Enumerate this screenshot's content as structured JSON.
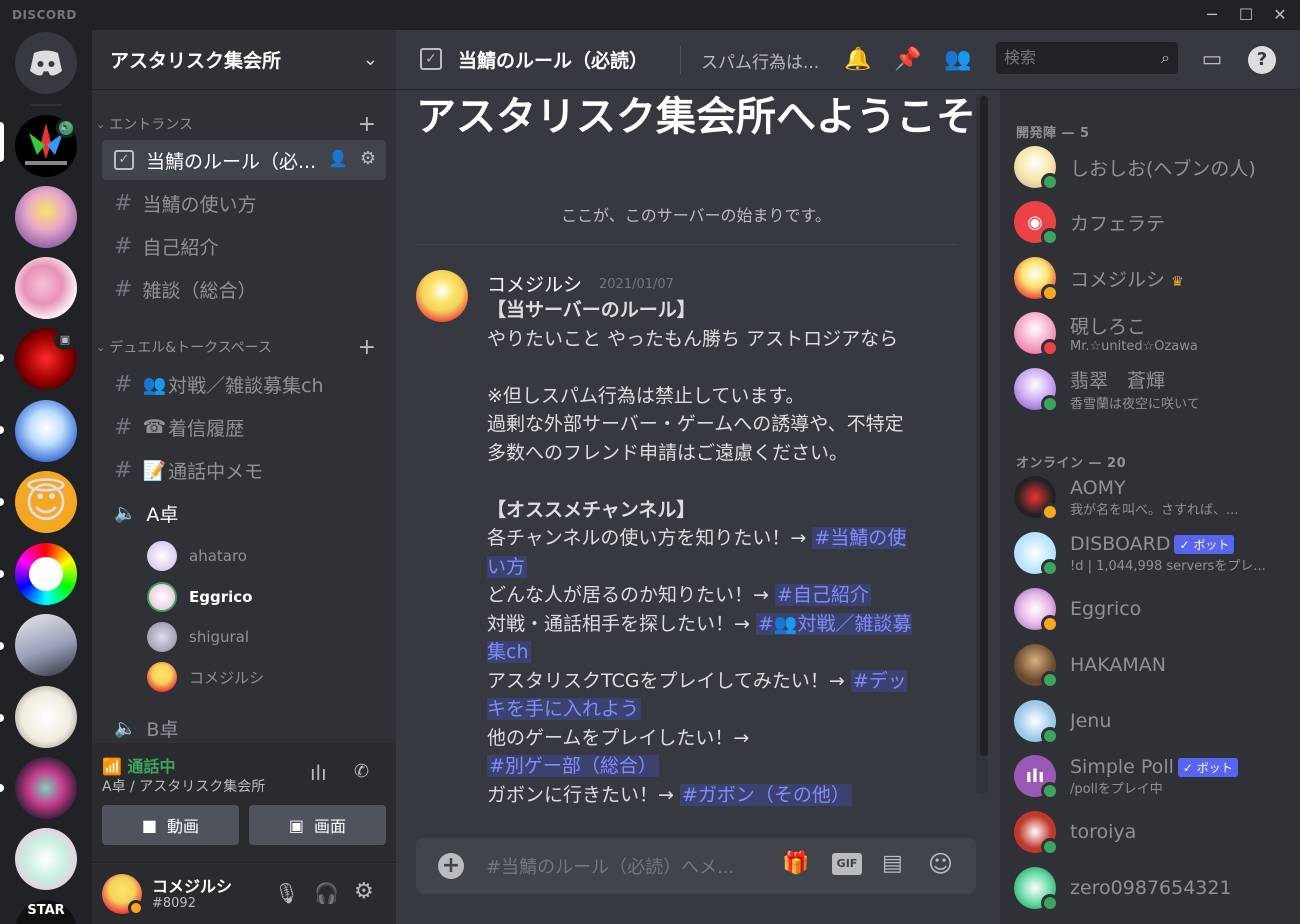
{
  "window": {
    "brand": "DISCORD"
  },
  "server": {
    "name": "アスタリスク集会所"
  },
  "categories": [
    {
      "name": "エントランス"
    },
    {
      "name": "デュエル&トークスペース"
    }
  ],
  "channels": {
    "rules": "当鯖のルール（必...",
    "howto": "当鯖の使い方",
    "intro": "自己紹介",
    "chat": "雑談（総合）",
    "match": "対戦／雑談募集ch",
    "callhist": "着信履歴",
    "memo": "通話中メモ",
    "voice_a": "A卓",
    "voice_b": "B卓"
  },
  "voice_users": [
    "ahataro",
    "Eggrico",
    "shigural",
    "コメジルシ"
  ],
  "voice_status": {
    "state": "通話中",
    "location": "A卓 / アスタリスク集会所",
    "video": "動画",
    "screen": "画面"
  },
  "user": {
    "name": "コメジルシ",
    "tag": "#8092"
  },
  "topbar": {
    "title": "当鯖のルール（必読）",
    "topic": "スパム行為は...",
    "search_placeholder": "検索"
  },
  "welcome": {
    "title": "アスタリスク集会所へようこそ",
    "subtitle": "ここが、このサーバーの始まりです。"
  },
  "message": {
    "author": "コメジルシ",
    "time": "2021/01/07",
    "l1": "【当サーバーのルール】",
    "l2": "やりたいこと やったもん勝ち アストロジアなら",
    "l3": "※但しスパム行為は禁止しています。",
    "l4": "過剰な外部サーバー・ゲームへの誘導や、不特定多数へのフレンド申請はご遠慮ください。",
    "l5": "【オススメチャンネル】",
    "r1": "各チャンネルの使い方を知りたい！→ ",
    "m1": "#当鯖の使い方",
    "r2": "どんな人が居るのか知りたい！→ ",
    "m2": "#自己紹介",
    "r3": "対戦・通話相手を探したい！→ ",
    "m3": "#👥対戦／雑談募集ch",
    "r4": "アスタリスクTCGをプレイしてみたい！→ ",
    "m4": "#デッキを手に入れよう",
    "r5": "他のゲームをプレイしたい！→ ",
    "m5": "#別ゲー部（総合）",
    "r6": "ガボンに行きたい！→ ",
    "m6": "#ガボン（その他）"
  },
  "composer": {
    "placeholder": "#当鯖のルール（必読）へメ..."
  },
  "member_groups": [
    {
      "label": "開発陣 — 5"
    },
    {
      "label": "オンライン — 20"
    }
  ],
  "members": [
    {
      "name": "しおしお(ヘブンの人)",
      "status": "",
      "presence": "online"
    },
    {
      "name": "カフェラテ",
      "status": "",
      "presence": "online"
    },
    {
      "name": "コメジルシ",
      "status": "",
      "presence": "idle"
    },
    {
      "name": "硯しろこ",
      "status": "Mr.☆united☆Ozawa",
      "presence": "dnd"
    },
    {
      "name": "翡翠　蒼輝",
      "status": "香雪蘭は夜空に咲いて",
      "presence": "online"
    },
    {
      "name": "AOMY",
      "status": "我が名を叫べ。さすれば、...",
      "presence": "idle"
    },
    {
      "name": "DISBOARD",
      "status": "!d | 1,044,998 serversをプレ...",
      "presence": "online",
      "bot": "✓ ボット"
    },
    {
      "name": "Eggrico",
      "status": "",
      "presence": "idle"
    },
    {
      "name": "HAKAMAN",
      "status": "",
      "presence": "online"
    },
    {
      "name": "Jenu",
      "status": "",
      "presence": "online"
    },
    {
      "name": "Simple Poll",
      "status": "/pollをプレイ中",
      "presence": "online",
      "bot": "✓ ボット"
    },
    {
      "name": "toroiya",
      "status": "",
      "presence": "online"
    },
    {
      "name": "zero0987654321",
      "status": "",
      "presence": "online"
    }
  ],
  "colors": {
    "accent": "#5865f2",
    "online": "#3ba55d",
    "idle": "#faa81a",
    "dnd": "#ed4245",
    "mention_bg": "#3c4270"
  }
}
